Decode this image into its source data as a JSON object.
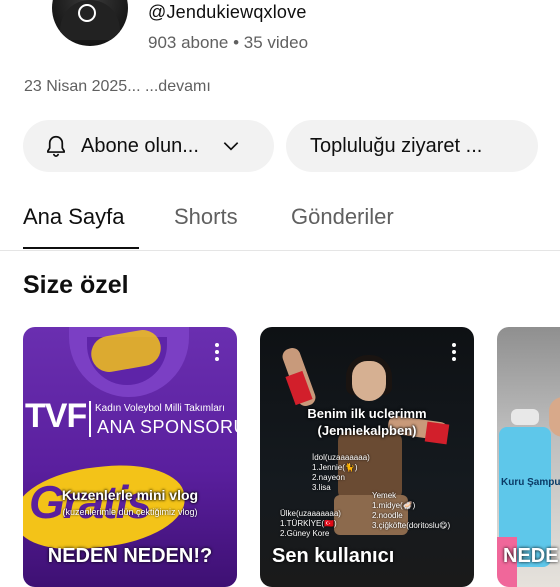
{
  "channel": {
    "handle": "@Jendukiewqxlove",
    "stats": "903 abone • 35 video",
    "description": "23 Nisan 2025... ...devamı"
  },
  "actions": {
    "subscribe_label": "Abone olun...",
    "visit_label": "Topluluğu ziyaret ..."
  },
  "tabs": [
    {
      "label": "Ana Sayfa",
      "active": true
    },
    {
      "label": "Shorts",
      "active": false
    },
    {
      "label": "Gönderiler",
      "active": false
    }
  ],
  "section": {
    "title": "Size özel"
  },
  "shorts": [
    {
      "brand_line": "TVF",
      "small_line": "Kadın Voleybol Milli Takımları",
      "sponsor_line": "ANA SPONSORU",
      "promo_word": "Gratis",
      "overlay_title": "Kuzenlerle mini vlog",
      "overlay_sub": "(kuzenlerimle dün çektiğimiz vlog)",
      "bottom_title": "NEDEN NEDEN!?"
    },
    {
      "overlay_title": "Benim ilk uclerimm\n(Jenniekalpben)",
      "list_a": "İdol(uzaaaaaaa)\n1.Jennie(🐈)\n2.nayeon\n3.lisa",
      "list_b": "Yemek\n1.midye(🦪)\n2.noodle\n3.çiğköfte(doritoslu😋)",
      "list_c": "Ülke(uzaaaaaaa)\n1.TÜRKİYE(🇹🇷)\n2.Güney Kore",
      "bottom_title": "Sen kullanıcı"
    },
    {
      "label": "Kuru Şampuan",
      "bottom_title": "NEDE"
    }
  ],
  "icons": {
    "bell": "bell-icon",
    "chevron": "chevron-down-icon",
    "more": "more-vert-icon"
  },
  "colors": {
    "button_bg": "#f2f2f2",
    "secondary_text": "#606060",
    "primary_text": "#0f0f0f"
  }
}
